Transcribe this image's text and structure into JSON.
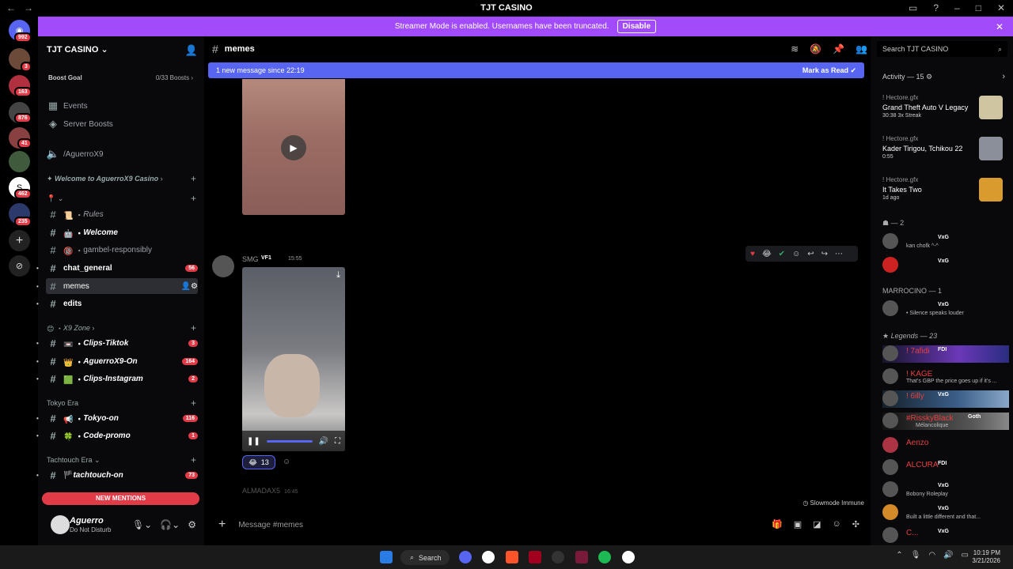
{
  "window": {
    "title": "TJT CASINO"
  },
  "banner": {
    "text": "Streamer Mode is enabled. Usernames have been truncated.",
    "disable_label": "Disable"
  },
  "guilds": {
    "badges": [
      "992",
      "3",
      "163",
      "876",
      "41",
      "462",
      "235"
    ]
  },
  "sidebar": {
    "server_name": "TJT CASINO",
    "boost_goal": "Boost Goal",
    "boosts": "0/33 Boosts",
    "events": "Events",
    "server_boosts": "Server Boosts",
    "channel_aguerro": "/AguerroX9",
    "cat_welcome": "Welcome to AguerroX9 Casino",
    "rules": "Rules",
    "welcome": "Welcome",
    "gambel": "gambel-responsibly",
    "chat_general": "chat_general",
    "chat_general_count": "56",
    "memes": "memes",
    "edits": "edits",
    "cat_x9": "X9 Zone",
    "clips_tiktok": "Clips-Tiktok",
    "clips_tiktok_count": "3",
    "aguerro_on": "AguerroX9-On",
    "aguerro_on_count": "164",
    "clips_instagram": "Clips-Instagram",
    "clips_instagram_count": "2",
    "cat_tokyo": "Tokyo Era",
    "tokyo_on": "Tokyo-on",
    "tokyo_on_count": "116",
    "code_promo": "Code-promo",
    "code_promo_count": "1",
    "cat_tachtouch": "Tachtouch Era",
    "tachtouch_on": "tachtouch-on",
    "tachtouch_on_count": "73",
    "new_mentions": "NEW MENTIONS"
  },
  "user": {
    "name": "Aguerro",
    "status": "Do Not Disturb"
  },
  "channel": {
    "name": "memes"
  },
  "new_messages": {
    "text": "1 new message since 22:19",
    "mark_read": "Mark as Read"
  },
  "message": {
    "author": "SMG",
    "tag": "VF1",
    "time": "15:55",
    "reaction_count": "13"
  },
  "next_message": {
    "author": "ALMADAX5",
    "time": "16:45"
  },
  "slowmode": "Slowmode Immune",
  "composer": {
    "placeholder": "Message #memes"
  },
  "right": {
    "search_placeholder": "Search TJT CASINO",
    "activity_header": "Activity — 15",
    "activities": [
      {
        "user": "! Hectore.gfx",
        "game": "Grand Theft Auto V Legacy",
        "meta": "30:38  3x Streak"
      },
      {
        "user": "! Hectore.gfx",
        "game": "Kader Tirigou, Tchikou 22",
        "meta": "0:55"
      },
      {
        "user": "! Hectore.gfx",
        "game": "It Takes Two",
        "meta": "1d ago"
      }
    ],
    "group_2": "— 2",
    "group_2_members": [
      {
        "tag": "VxG",
        "status": "kan chofk ^-^"
      },
      {
        "tag": "VxG",
        "status": ""
      }
    ],
    "group_marrocino": "MARROCINO — 1",
    "marrocino_member": {
      "tag": "VxG",
      "status": "• Silence speaks louder"
    },
    "group_legends": "Legends — 23",
    "legends": [
      {
        "name": "! 7afidi",
        "tag": "FDI",
        "status": ""
      },
      {
        "name": "! KAGE",
        "tag": "",
        "status": "That's GBP the price goes up if it's ..."
      },
      {
        "name": "! 6illy",
        "tag": "VxG",
        "status": ""
      },
      {
        "name": "#RisskyBlack",
        "tag": "Goth",
        "status": "Mélancolique"
      },
      {
        "name": "Aenzo",
        "tag": "",
        "status": ""
      },
      {
        "name": "ALCURA",
        "tag": "FDI",
        "status": ""
      },
      {
        "name": "",
        "tag": "VxG",
        "status": "Bobony Roleplay"
      },
      {
        "name": "",
        "tag": "VxG",
        "status": "Built a little different and that..."
      },
      {
        "name": "C...",
        "tag": "VxG",
        "status": ""
      }
    ]
  },
  "taskbar": {
    "search": "Search",
    "time": "10:19 PM",
    "date": "3/21/2026"
  },
  "colors": {
    "accent": "#5865f2",
    "banner": "#a24bfa",
    "mention": "#e23b48"
  }
}
